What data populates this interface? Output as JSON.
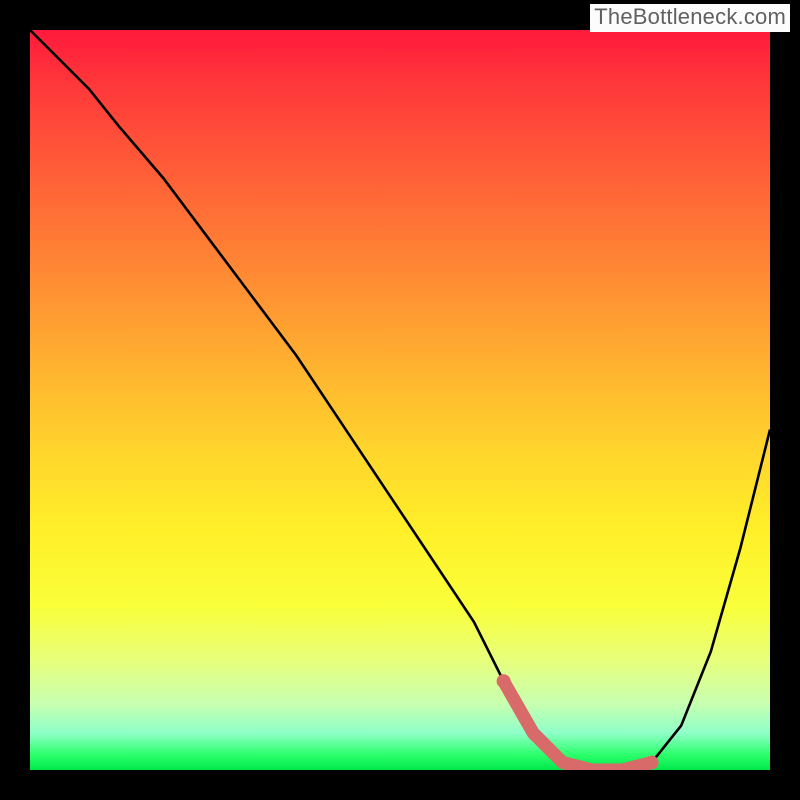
{
  "attribution": "TheBottleneck.com",
  "chart_data": {
    "type": "line",
    "title": "",
    "xlabel": "",
    "ylabel": "",
    "x_range": [
      0,
      100
    ],
    "y_range": [
      0,
      100
    ],
    "series": [
      {
        "name": "bottleneck-curve",
        "x": [
          0,
          4,
          8,
          12,
          18,
          24,
          30,
          36,
          42,
          48,
          54,
          60,
          64,
          68,
          72,
          76,
          80,
          84,
          88,
          92,
          96,
          100
        ],
        "y": [
          100,
          96,
          92,
          87,
          80,
          72,
          64,
          56,
          47,
          38,
          29,
          20,
          12,
          5,
          1,
          0,
          0,
          1,
          6,
          16,
          30,
          46
        ]
      }
    ],
    "highlight_segment": {
      "name": "optimal-range",
      "x": [
        64,
        68,
        72,
        76,
        80,
        84
      ],
      "y": [
        12,
        5,
        1,
        0,
        0,
        1
      ]
    },
    "gradient_stops": [
      {
        "pos": 0.0,
        "color": "#ff1a3c"
      },
      {
        "pos": 0.5,
        "color": "#ffd82c"
      },
      {
        "pos": 0.85,
        "color": "#e8ff7a"
      },
      {
        "pos": 1.0,
        "color": "#00e84a"
      }
    ],
    "curve_color": "#000000",
    "highlight_color": "#d86a6a"
  }
}
